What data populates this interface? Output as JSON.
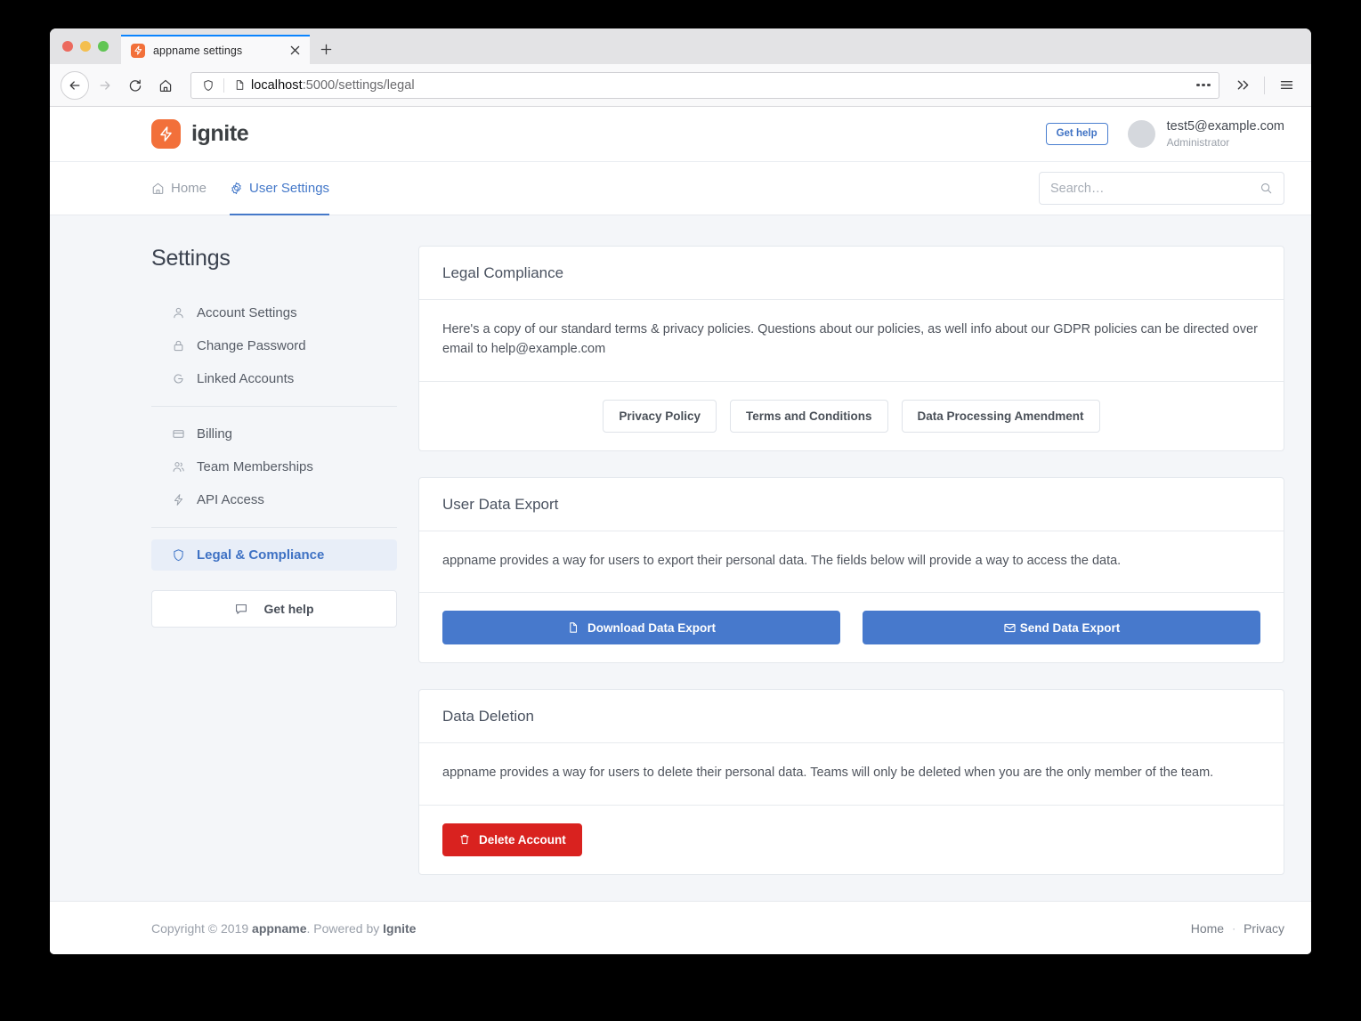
{
  "browser": {
    "tab": {
      "title": "appname settings",
      "favicon": "bolt-icon",
      "close": "×"
    },
    "new_tab_label": "+",
    "url": {
      "scheme_host": "localhost",
      "rest": ":5000/settings/legal",
      "full": "localhost:5000/settings/legal"
    },
    "controls": {
      "back": "back-arrow-icon",
      "forward": "forward-arrow-icon",
      "reload": "reload-icon",
      "home": "home-icon",
      "shield": "shield-icon",
      "page": "page-icon",
      "more": "ellipsis-icon",
      "overflow": "double-chevron-icon",
      "menu": "hamburger-icon"
    }
  },
  "header": {
    "brand_name": "ignite",
    "brand_mark": "bolt-icon",
    "get_help_label": "Get help",
    "user_email": "test5@example.com",
    "user_role": "Administrator"
  },
  "nav": {
    "tabs": [
      {
        "label": "Home",
        "icon": "home-icon",
        "active": false
      },
      {
        "label": "User Settings",
        "icon": "gear-icon",
        "active": true
      }
    ],
    "search_placeholder": "Search…",
    "search_value": ""
  },
  "sidebar": {
    "title": "Settings",
    "groups": [
      [
        {
          "label": "Account Settings",
          "icon": "user-icon",
          "active": false
        },
        {
          "label": "Change Password",
          "icon": "lock-icon",
          "active": false
        },
        {
          "label": "Linked Accounts",
          "icon": "google-g-icon",
          "active": false
        }
      ],
      [
        {
          "label": "Billing",
          "icon": "credit-card-icon",
          "active": false
        },
        {
          "label": "Team Memberships",
          "icon": "users-icon",
          "active": false
        },
        {
          "label": "API Access",
          "icon": "bolt-icon",
          "active": false
        }
      ],
      [
        {
          "label": "Legal & Compliance",
          "icon": "shield-icon",
          "active": true
        }
      ]
    ],
    "get_help_label": "Get help",
    "get_help_icon": "chat-bubble-icon"
  },
  "main": {
    "cards": [
      {
        "title": "Legal Compliance",
        "body": "Here's a copy of our standard terms & privacy policies. Questions about our policies, as well info about our GDPR policies can be directed over email to help@example.com",
        "buttons": [
          {
            "label": "Privacy Policy",
            "style": "outline"
          },
          {
            "label": "Terms and Conditions",
            "style": "outline"
          },
          {
            "label": "Data Processing Amendment",
            "style": "outline"
          }
        ]
      },
      {
        "title": "User Data Export",
        "body": "appname provides a way for users to export their personal data. The fields below will provide a way to access the data.",
        "buttons": [
          {
            "label": "Download Data Export",
            "style": "primary",
            "icon": "file-icon"
          },
          {
            "label": "Send Data Export",
            "style": "primary",
            "icon": "envelope-icon"
          }
        ]
      },
      {
        "title": "Data Deletion",
        "body": "appname provides a way for users to delete their personal data. Teams will only be deleted when you are the only member of the team.",
        "buttons": [
          {
            "label": "Delete Account",
            "style": "danger",
            "icon": "trash-icon"
          }
        ]
      }
    ]
  },
  "footer": {
    "copyright_prefix": "Copyright © 2019 ",
    "copyright_app": "appname",
    "copyright_mid": ". Powered by ",
    "copyright_engine": "Ignite",
    "links": [
      {
        "label": "Home"
      },
      {
        "label": "Privacy"
      }
    ],
    "separator": "·"
  },
  "colors": {
    "brand_orange": "#f2703a",
    "accent_blue": "#4779cc",
    "danger_red": "#d9221f",
    "page_bg": "#f4f6f9",
    "active_nav_bg": "#e8eef8"
  }
}
